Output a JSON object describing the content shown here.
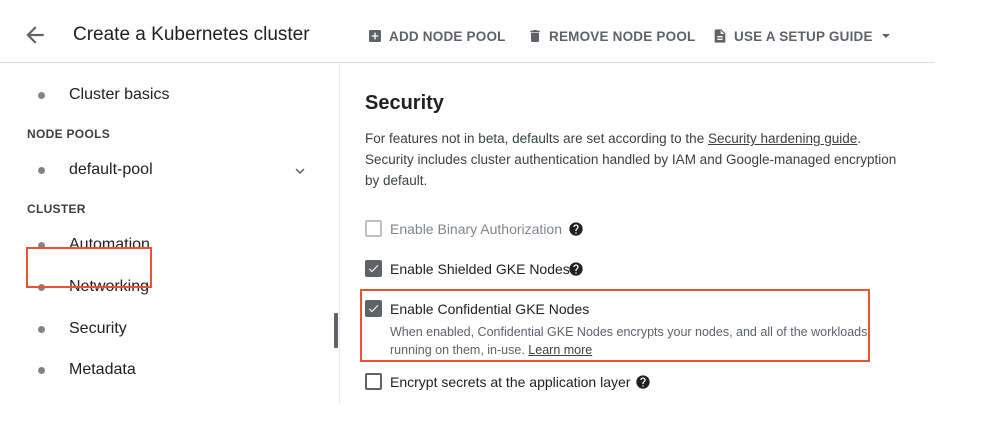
{
  "header": {
    "title": "Create a Kubernetes cluster",
    "back_icon": "arrow-back-icon",
    "actions": [
      {
        "label": "ADD NODE POOL",
        "icon": "add-box-icon"
      },
      {
        "label": "REMOVE NODE POOL",
        "icon": "trash-icon"
      },
      {
        "label": "USE A SETUP GUIDE",
        "icon": "document-icon"
      }
    ]
  },
  "sidebar": {
    "items": [
      {
        "label": "Cluster basics"
      },
      {
        "section": "NODE POOLS"
      },
      {
        "label": "default-pool",
        "expandable": true
      },
      {
        "section": "CLUSTER"
      },
      {
        "label": "Automation"
      },
      {
        "label": "Networking"
      },
      {
        "label": "Security",
        "selected": true
      },
      {
        "label": "Metadata"
      }
    ]
  },
  "main": {
    "title": "Security",
    "description": {
      "before_link": "For features not in beta, defaults are set according to the ",
      "link": "Security hardening guide",
      "after_link": ". Security includes cluster authentication handled by IAM and Google-managed encryption by default."
    },
    "options": [
      {
        "label": "Enable Binary Authorization",
        "checked": false,
        "disabled": true
      },
      {
        "label": "Enable Shielded GKE Nodes",
        "checked": true,
        "disabled": false
      },
      {
        "label": "Enable Confidential GKE Nodes",
        "checked": true,
        "disabled": false,
        "description": "When enabled, Confidential GKE Nodes encrypts your nodes, and all of the workloads running on them, in-use.",
        "link": "Learn more"
      },
      {
        "label": "Encrypt secrets at the application layer",
        "checked": false,
        "disabled": false
      }
    ]
  },
  "colors": {
    "highlight": "#e8542f",
    "checkbox": "#5f6368",
    "text": "#202124"
  }
}
